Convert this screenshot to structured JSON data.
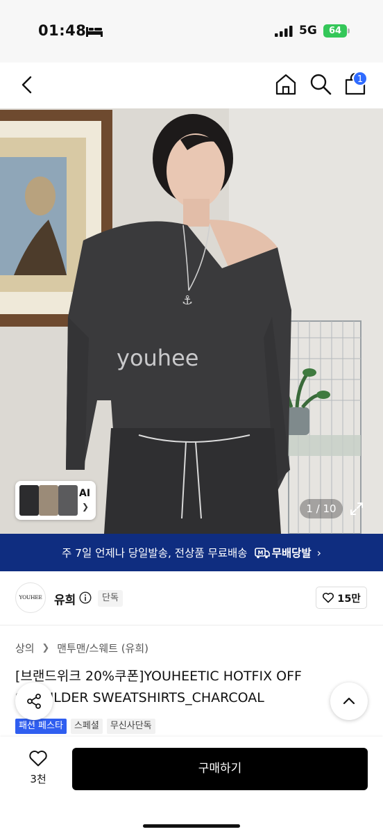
{
  "status_bar": {
    "time": "01:48",
    "network": "5G",
    "battery": "64"
  },
  "nav": {
    "cart_count": "1"
  },
  "gallery": {
    "ai_label": "AI",
    "page_counter": "1 / 10",
    "shirt_text": "youhee"
  },
  "promo_banner": {
    "text": "주 7일 언제나 당일발송, 전상품 무료배송",
    "logo_text": "무배당발"
  },
  "brand": {
    "logo_text": "YOUHEE",
    "name": "유희",
    "badge": "단독",
    "like_count": "15만"
  },
  "product": {
    "breadcrumb": [
      "상의",
      "맨투맨/스웨트 (유희)"
    ],
    "title": "[브랜드위크 20%쿠폰]YOUHEETIC HOTFIX OFF SHOULDER SWEATSHIRTS_CHARCOAL",
    "tags": [
      "패션 페스타",
      "스페셜",
      "무신사단독"
    ]
  },
  "bottom_bar": {
    "wish_count": "3천",
    "buy_label": "구매하기"
  },
  "colors": {
    "banner_bg": "#0f2d80",
    "badge_blue": "#2f6bff",
    "tag_blue": "#2f5ef0",
    "battery_green": "#34c759",
    "buy_button": "#000000"
  },
  "icons": [
    "bed-icon",
    "signal-icon",
    "back-icon",
    "home-icon",
    "search-icon",
    "cart-icon",
    "expand-icon",
    "chevron-right-icon",
    "info-icon",
    "heart-icon",
    "share-icon",
    "chevron-up-icon"
  ]
}
